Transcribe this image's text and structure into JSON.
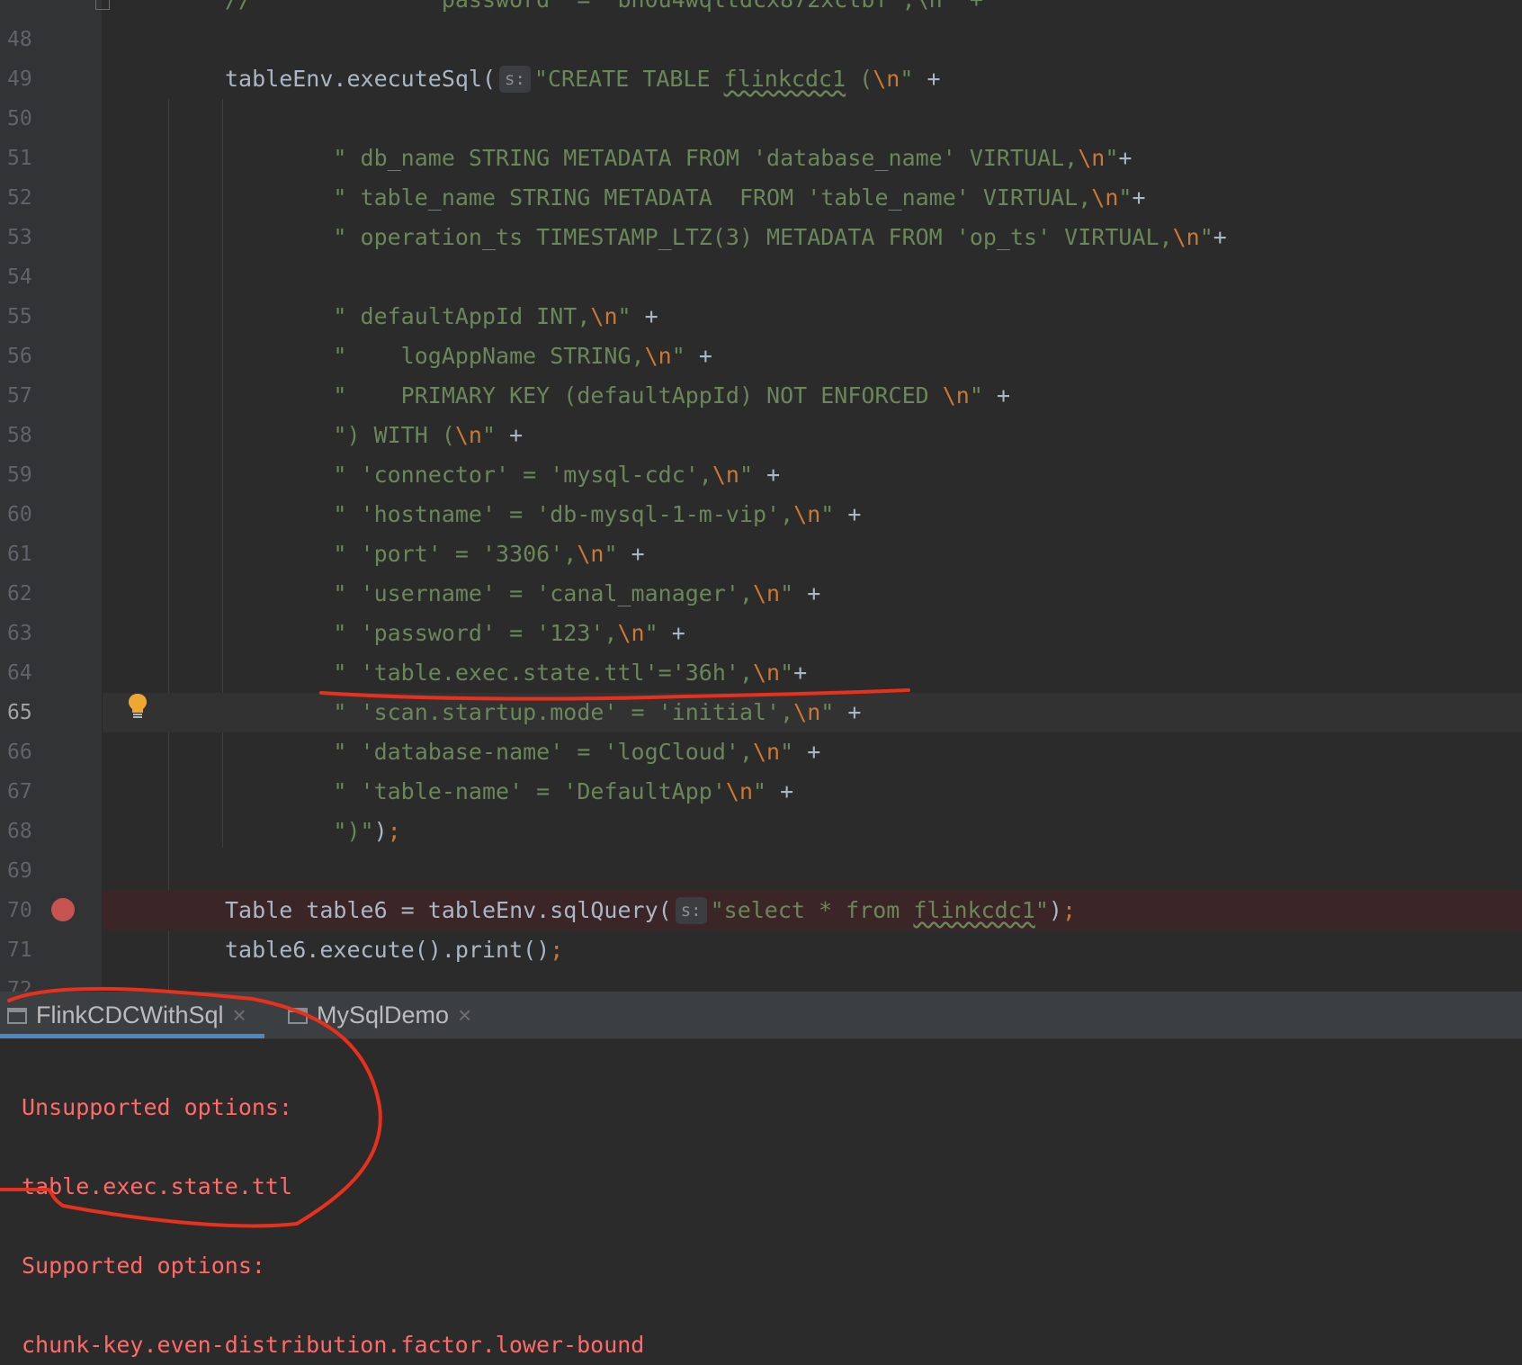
{
  "editor": {
    "top_partial_text": "//              password  =  bh0u4wqltdcx872xctbf',\\n\" +",
    "lines": [
      {
        "num": "48",
        "segs": []
      },
      {
        "num": "49",
        "segs": [
          {
            "t": "p",
            "v": "tableEnv.executeSql("
          },
          {
            "t": "h",
            "v": "s:"
          },
          {
            "t": "s",
            "v": "\"CREATE TABLE "
          },
          {
            "t": "sw",
            "v": "flinkcdc1"
          },
          {
            "t": "s",
            "v": " ("
          },
          {
            "t": "e",
            "v": "\\n"
          },
          {
            "t": "s",
            "v": "\""
          },
          {
            "t": "p",
            "v": " +"
          }
        ]
      },
      {
        "num": "50",
        "segs": []
      },
      {
        "num": "51",
        "segs": [
          {
            "t": "s",
            "v": "        \" db_name STRING METADATA FROM 'database_name' VIRTUAL,"
          },
          {
            "t": "e",
            "v": "\\n"
          },
          {
            "t": "s",
            "v": "\""
          },
          {
            "t": "p",
            "v": "+"
          }
        ]
      },
      {
        "num": "52",
        "segs": [
          {
            "t": "s",
            "v": "        \" table_name STRING METADATA  FROM 'table_name' VIRTUAL,"
          },
          {
            "t": "e",
            "v": "\\n"
          },
          {
            "t": "s",
            "v": "\""
          },
          {
            "t": "p",
            "v": "+"
          }
        ]
      },
      {
        "num": "53",
        "segs": [
          {
            "t": "s",
            "v": "        \" operation_ts TIMESTAMP_LTZ(3) METADATA FROM 'op_ts' VIRTUAL,"
          },
          {
            "t": "e",
            "v": "\\n"
          },
          {
            "t": "s",
            "v": "\""
          },
          {
            "t": "p",
            "v": "+"
          }
        ]
      },
      {
        "num": "54",
        "segs": []
      },
      {
        "num": "55",
        "segs": [
          {
            "t": "s",
            "v": "        \" defaultAppId INT,"
          },
          {
            "t": "e",
            "v": "\\n"
          },
          {
            "t": "s",
            "v": "\""
          },
          {
            "t": "p",
            "v": " +"
          }
        ]
      },
      {
        "num": "56",
        "segs": [
          {
            "t": "s",
            "v": "        \"    logAppName STRING,"
          },
          {
            "t": "e",
            "v": "\\n"
          },
          {
            "t": "s",
            "v": "\""
          },
          {
            "t": "p",
            "v": " +"
          }
        ]
      },
      {
        "num": "57",
        "segs": [
          {
            "t": "s",
            "v": "        \"    PRIMARY KEY (defaultAppId) NOT ENFORCED "
          },
          {
            "t": "e",
            "v": "\\n"
          },
          {
            "t": "s",
            "v": "\""
          },
          {
            "t": "p",
            "v": " +"
          }
        ]
      },
      {
        "num": "58",
        "segs": [
          {
            "t": "s",
            "v": "        \") WITH ("
          },
          {
            "t": "e",
            "v": "\\n"
          },
          {
            "t": "s",
            "v": "\""
          },
          {
            "t": "p",
            "v": " +"
          }
        ]
      },
      {
        "num": "59",
        "segs": [
          {
            "t": "s",
            "v": "        \" 'connector' = 'mysql-cdc',"
          },
          {
            "t": "e",
            "v": "\\n"
          },
          {
            "t": "s",
            "v": "\""
          },
          {
            "t": "p",
            "v": " +"
          }
        ]
      },
      {
        "num": "60",
        "segs": [
          {
            "t": "s",
            "v": "        \" 'hostname' = 'db-mysql-1-m-vip',"
          },
          {
            "t": "e",
            "v": "\\n"
          },
          {
            "t": "s",
            "v": "\""
          },
          {
            "t": "p",
            "v": " +"
          }
        ]
      },
      {
        "num": "61",
        "segs": [
          {
            "t": "s",
            "v": "        \" 'port' = '3306',"
          },
          {
            "t": "e",
            "v": "\\n"
          },
          {
            "t": "s",
            "v": "\""
          },
          {
            "t": "p",
            "v": " +"
          }
        ]
      },
      {
        "num": "62",
        "segs": [
          {
            "t": "s",
            "v": "        \" 'username' = 'canal_manager',"
          },
          {
            "t": "e",
            "v": "\\n"
          },
          {
            "t": "s",
            "v": "\""
          },
          {
            "t": "p",
            "v": " +"
          }
        ]
      },
      {
        "num": "63",
        "segs": [
          {
            "t": "s",
            "v": "        \" 'password' = '123',"
          },
          {
            "t": "e",
            "v": "\\n"
          },
          {
            "t": "s",
            "v": "\""
          },
          {
            "t": "p",
            "v": " +"
          }
        ]
      },
      {
        "num": "64",
        "segs": [
          {
            "t": "s",
            "v": "        \" 'table.exec.state.ttl'='36h',"
          },
          {
            "t": "e",
            "v": "\\n"
          },
          {
            "t": "s",
            "v": "\""
          },
          {
            "t": "p",
            "v": "+"
          }
        ]
      },
      {
        "num": "65",
        "current": true,
        "segs": [
          {
            "t": "s",
            "v": "        \" 'scan.startup.mode' = 'initial',"
          },
          {
            "t": "e",
            "v": "\\n"
          },
          {
            "t": "s",
            "v": "\""
          },
          {
            "t": "p",
            "v": " +"
          }
        ]
      },
      {
        "num": "66",
        "segs": [
          {
            "t": "s",
            "v": "        \" 'database-name' = 'logCloud',"
          },
          {
            "t": "e",
            "v": "\\n"
          },
          {
            "t": "s",
            "v": "\""
          },
          {
            "t": "p",
            "v": " +"
          }
        ]
      },
      {
        "num": "67",
        "segs": [
          {
            "t": "s",
            "v": "        \" 'table-name' = 'DefaultApp'"
          },
          {
            "t": "e",
            "v": "\\n"
          },
          {
            "t": "s",
            "v": "\""
          },
          {
            "t": "p",
            "v": " +"
          }
        ]
      },
      {
        "num": "68",
        "segs": [
          {
            "t": "s",
            "v": "        \")\""
          },
          {
            "t": "p",
            "v": ")"
          },
          {
            "t": "e",
            "v": ";"
          }
        ]
      },
      {
        "num": "69",
        "segs": []
      },
      {
        "num": "70",
        "breakpoint": true,
        "segs": [
          {
            "t": "p",
            "v": "Table table6 = tableEnv.sqlQuery("
          },
          {
            "t": "h",
            "v": "s:"
          },
          {
            "t": "s",
            "v": "\"select * from "
          },
          {
            "t": "sw",
            "v": "flinkcdc1"
          },
          {
            "t": "s",
            "v": "\""
          },
          {
            "t": "p",
            "v": ")"
          },
          {
            "t": "e",
            "v": ";"
          }
        ]
      },
      {
        "num": "71",
        "segs": [
          {
            "t": "p",
            "v": "table6.execute().print()"
          },
          {
            "t": "e",
            "v": ";"
          }
        ]
      }
    ],
    "partial_bottom_num": "72"
  },
  "tabs": [
    {
      "label": "FlinkCDCWithSql",
      "active": true,
      "close": "×"
    },
    {
      "label": "MySqlDemo",
      "active": false,
      "close": "×"
    }
  ],
  "console": {
    "lines": [
      "Unsupported options:",
      "",
      "table.exec.state.ttl",
      "",
      "Supported options:",
      "",
      "chunk-key.even-distribution.factor.lower-bound"
    ]
  },
  "colors": {
    "string": "#6a8759",
    "escape": "#cc7832",
    "plain": "#a9b7c6",
    "error_text": "#ff6b68",
    "annotation": "#e8301c",
    "breakpoint": "#c75450",
    "bulb": "#f0a732"
  },
  "icons": [
    "lightbulb-icon",
    "breakpoint-icon",
    "console-tab-icon",
    "close-icon"
  ]
}
